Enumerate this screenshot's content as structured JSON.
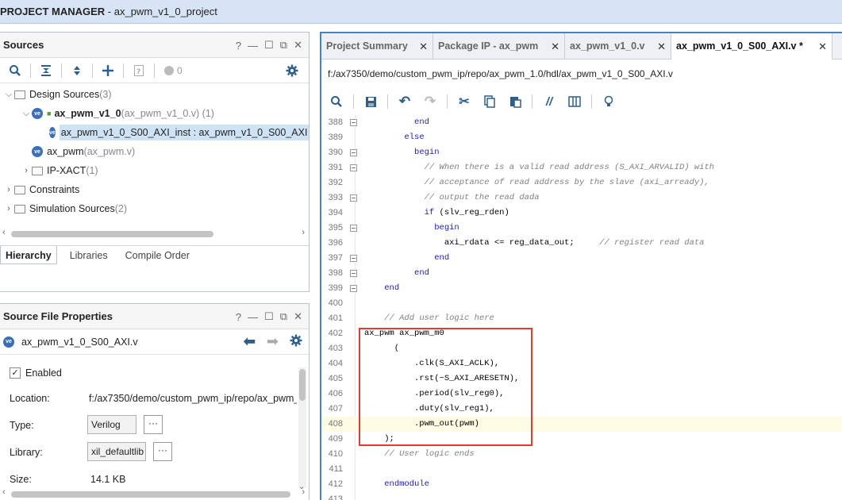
{
  "window": {
    "title_prefix": "PROJECT MANAGER",
    "title_rest": " - ax_pwm_v1_0_project"
  },
  "sources": {
    "title": "Sources",
    "controls": [
      "?",
      "—",
      "☐",
      "⧉",
      "✕"
    ],
    "toolbar_badge": "0",
    "tree": [
      {
        "arrow": "⌵",
        "label": "Design Sources",
        "extra": " (3)"
      },
      {
        "arrow": "⌵",
        "label": "ax_pwm_v1_0",
        "extra": " (ax_pwm_v1_0.v) (1)"
      },
      {
        "arrow": "",
        "label": "ax_pwm_v1_0_S00_AXI_inst : ax_pwm_v1_0_S00_AXI",
        "extra": ""
      },
      {
        "arrow": "",
        "label": "ax_pwm",
        "extra": " (ax_pwm.v)"
      },
      {
        "arrow": "›",
        "label": "IP-XACT",
        "extra": " (1)"
      },
      {
        "arrow": "›",
        "label": "Constraints",
        "extra": ""
      },
      {
        "arrow": "›",
        "label": "Simulation Sources",
        "extra": " (2)"
      }
    ],
    "tabs": [
      "Hierarchy",
      "Libraries",
      "Compile Order"
    ]
  },
  "props": {
    "title": "Source File Properties",
    "controls": [
      "?",
      "—",
      "☐",
      "⧉",
      "✕"
    ],
    "file": "ax_pwm_v1_0_S00_AXI.v",
    "enabled_label": "Enabled",
    "location_label": "Location:",
    "location_value": "f:/ax7350/demo/custom_pwm_ip/repo/ax_pwm_",
    "type_label": "Type:",
    "type_value": "Verilog",
    "library_label": "Library:",
    "library_value": "xil_defaultlib",
    "size_label": "Size:",
    "size_value": "14.1 KB",
    "ellipsis": "···"
  },
  "editor": {
    "tabs": [
      {
        "label": "Project Summary",
        "close": "✕"
      },
      {
        "label": "Package IP - ax_pwm",
        "close": "✕"
      },
      {
        "label": "ax_pwm_v1_0.v",
        "close": "✕"
      },
      {
        "label": "ax_pwm_v1_0_S00_AXI.v *",
        "close": "✕"
      }
    ],
    "path": "f:/ax7350/demo/custom_pwm_ip/repo/ax_pwm_1.0/hdl/ax_pwm_v1_0_S00_AXI.v",
    "lines": [
      {
        "n": "388",
        "t": "          end"
      },
      {
        "n": "389",
        "t": "        else"
      },
      {
        "n": "390",
        "t": "          begin"
      },
      {
        "n": "391",
        "t": "            // When there is a valid read address (S_AXI_ARVALID) with"
      },
      {
        "n": "392",
        "t": "            // acceptance of read address by the slave (axi_arready),"
      },
      {
        "n": "393",
        "t": "            // output the read dada"
      },
      {
        "n": "394",
        "t": "            if (slv_reg_rden)"
      },
      {
        "n": "395",
        "t": "              begin"
      },
      {
        "n": "396",
        "t": "                axi_rdata <= reg_data_out;     // register read data"
      },
      {
        "n": "397",
        "t": "              end"
      },
      {
        "n": "398",
        "t": "          end"
      },
      {
        "n": "399",
        "t": "    end"
      },
      {
        "n": "400",
        "t": ""
      },
      {
        "n": "401",
        "t": "    // Add user logic here"
      },
      {
        "n": "402",
        "t": "ax_pwm ax_pwm_m0"
      },
      {
        "n": "403",
        "t": "      ("
      },
      {
        "n": "404",
        "t": "          .clk(S_AXI_ACLK),"
      },
      {
        "n": "405",
        "t": "          .rst(~S_AXI_ARESETN),"
      },
      {
        "n": "406",
        "t": "          .period(slv_reg0),"
      },
      {
        "n": "407",
        "t": "          .duty(slv_reg1),"
      },
      {
        "n": "408",
        "t": "          .pwm_out(pwm)"
      },
      {
        "n": "409",
        "t": "    );"
      },
      {
        "n": "410",
        "t": "    // User logic ends"
      },
      {
        "n": "411",
        "t": ""
      },
      {
        "n": "412",
        "t": "    endmodule"
      },
      {
        "n": "413",
        "t": ""
      }
    ]
  }
}
